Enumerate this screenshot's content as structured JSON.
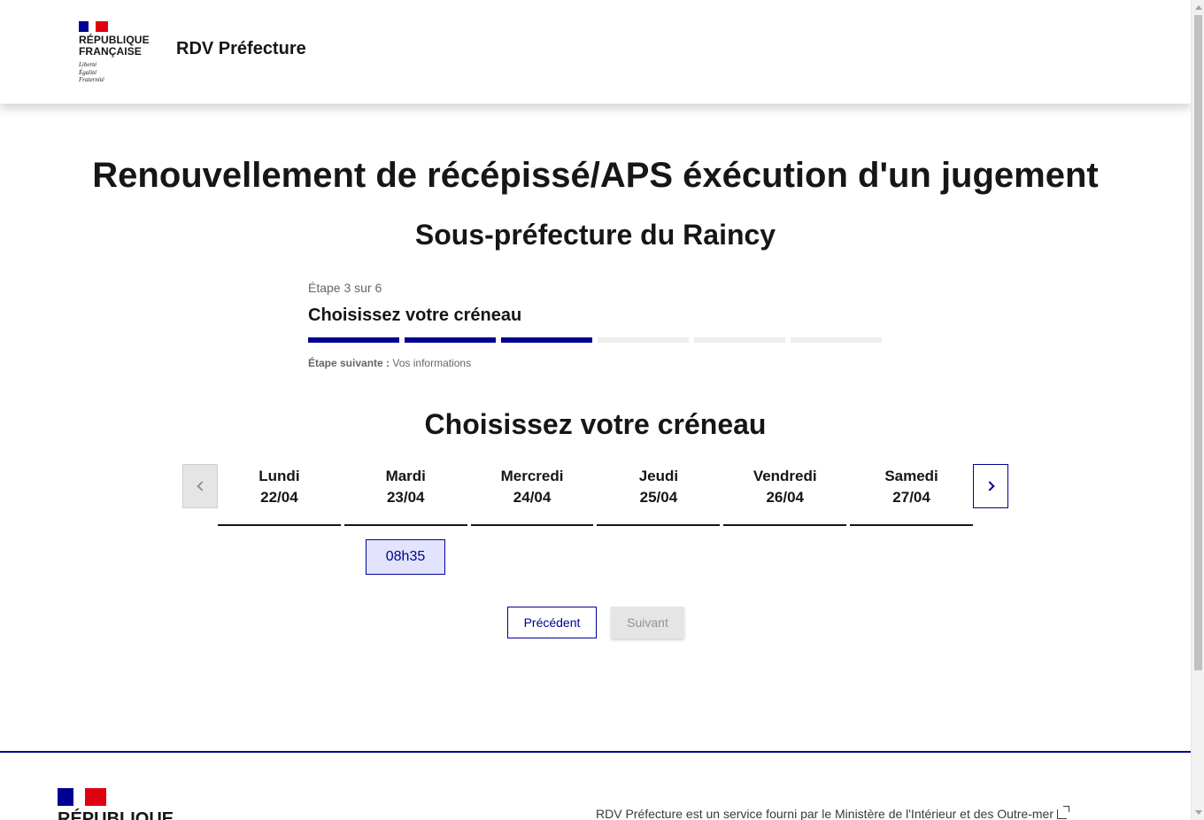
{
  "header": {
    "logo_line1": "RÉPUBLIQUE",
    "logo_line2": "FRANÇAISE",
    "motto_line1": "Liberté",
    "motto_line2": "Égalité",
    "motto_line3": "Fraternité",
    "service_title": "RDV Préfecture"
  },
  "main": {
    "title": "Renouvellement de récépissé/APS éxécution d'un jugement",
    "subtitle": "Sous-préfecture du Raincy"
  },
  "stepper": {
    "state": "Étape 3 sur 6",
    "title": "Choisissez votre créneau",
    "next_label": "Étape suivante :",
    "next_value": "Vos informations",
    "current_step": 3,
    "total_steps": 6
  },
  "slots": {
    "title": "Choisissez votre créneau",
    "days": [
      {
        "name": "Lundi",
        "date": "22/04"
      },
      {
        "name": "Mardi",
        "date": "23/04"
      },
      {
        "name": "Mercredi",
        "date": "24/04"
      },
      {
        "name": "Jeudi",
        "date": "25/04"
      },
      {
        "name": "Vendredi",
        "date": "26/04"
      },
      {
        "name": "Samedi",
        "date": "27/04"
      }
    ],
    "time_slot": "08h35"
  },
  "actions": {
    "previous": "Précédent",
    "next": "Suivant"
  },
  "footer": {
    "logo_line1": "RÉPUBLIQUE",
    "description": "RDV Préfecture est un service fourni par le Ministère de l'Intérieur et des Outre-mer"
  },
  "colors": {
    "primary": "#000091",
    "marianne_red": "#e1000f",
    "slot_bg": "#e3e3fd",
    "disabled": "#e5e5e5"
  }
}
